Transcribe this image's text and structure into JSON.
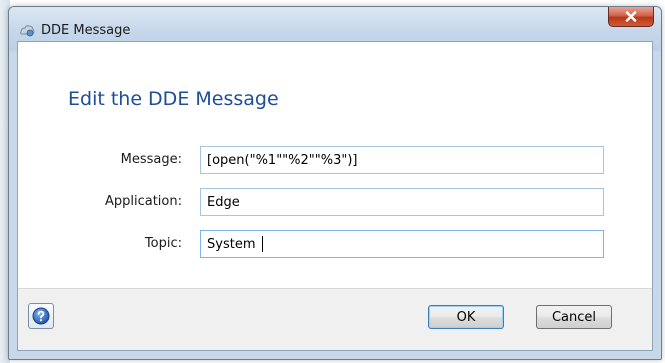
{
  "window": {
    "title": "DDE Message",
    "close_icon": "close-icon"
  },
  "dialog": {
    "heading": "Edit the DDE Message",
    "fields": [
      {
        "label": "Message:",
        "value": "[open(\"%1\"\"%2\"\"%3\")]"
      },
      {
        "label": "Application:",
        "value": "Edge"
      },
      {
        "label": "Topic:",
        "value": "System"
      }
    ]
  },
  "footer": {
    "help_icon": "help-icon",
    "ok_label": "OK",
    "cancel_label": "Cancel"
  },
  "colors": {
    "heading": "#1f4e99",
    "close_button": "#c9452a",
    "help_icon": "#1f5fbf"
  }
}
